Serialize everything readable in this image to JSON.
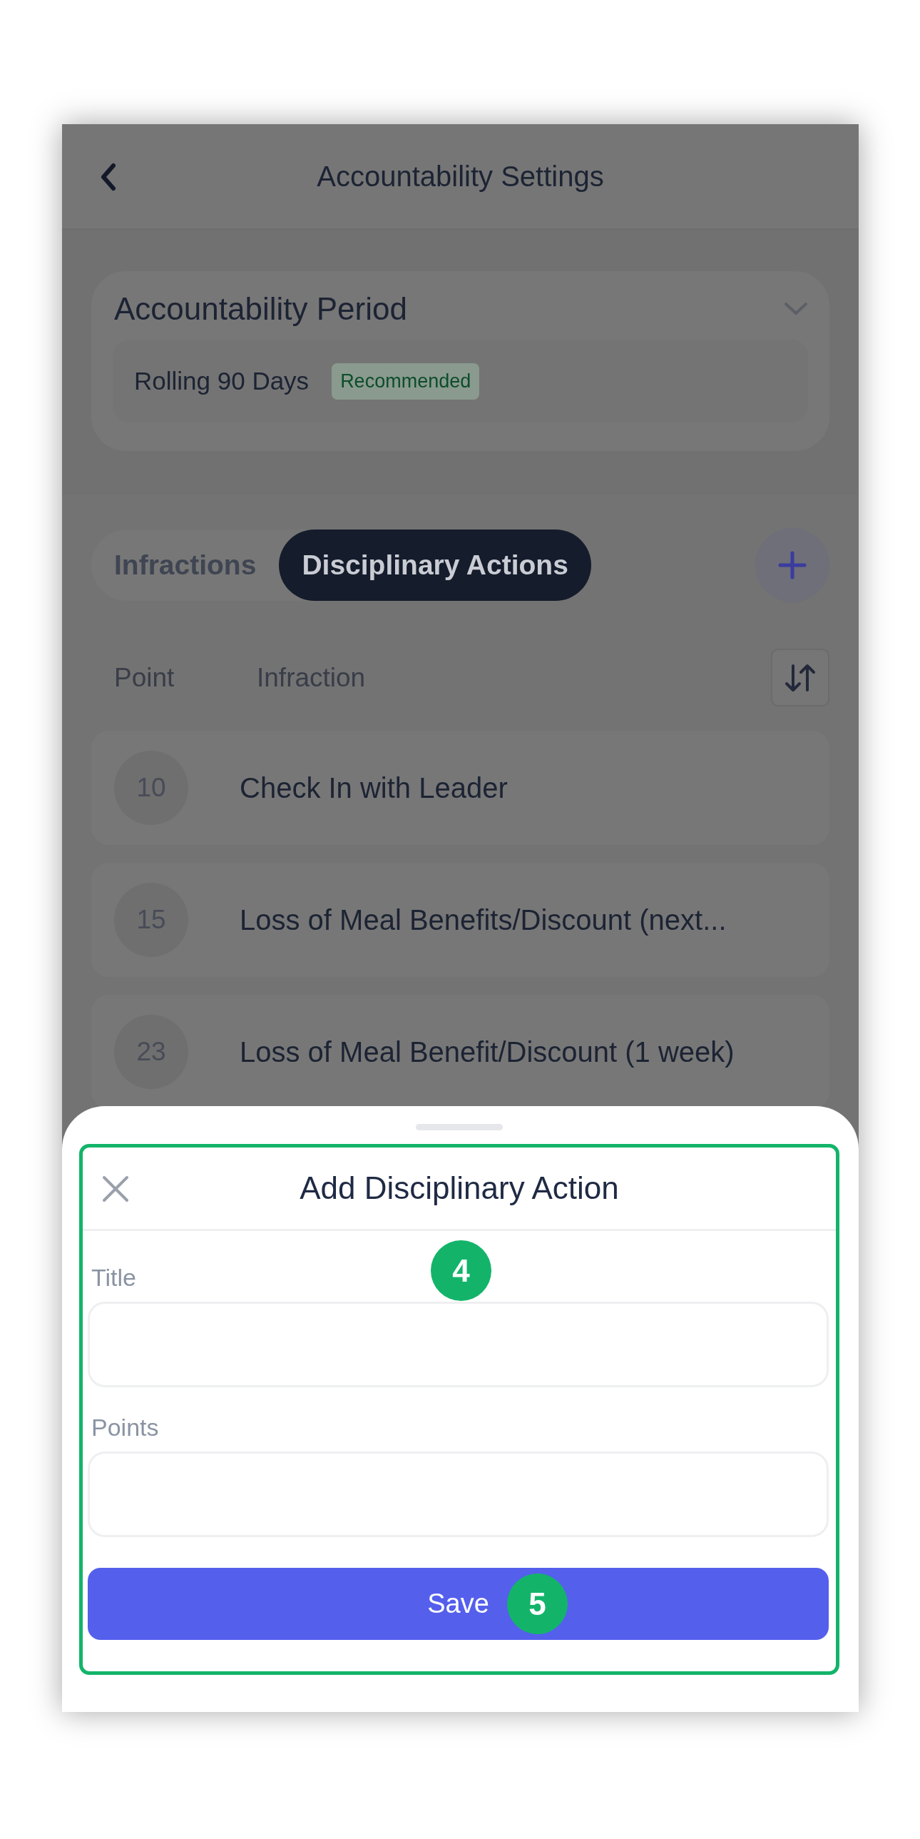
{
  "header": {
    "title": "Accountability Settings"
  },
  "period": {
    "title": "Accountability Period",
    "value": "Rolling 90 Days",
    "badge": "Recommended"
  },
  "tabs": [
    {
      "label": "Infractions",
      "selected": false
    },
    {
      "label": "Disciplinary Actions",
      "selected": true
    }
  ],
  "table": {
    "columns": [
      "Point",
      "Infraction"
    ],
    "rows": [
      {
        "points": "10",
        "title": "Check In with Leader"
      },
      {
        "points": "15",
        "title": "Loss of Meal Benefits/Discount (next..."
      },
      {
        "points": "23",
        "title": "Loss of Meal Benefit/Discount (1 week)"
      }
    ]
  },
  "sheet": {
    "title": "Add Disciplinary Action",
    "fields": [
      {
        "label": "Title"
      },
      {
        "label": "Points"
      }
    ],
    "button": "Save"
  },
  "annotations": [
    {
      "number": "4"
    },
    {
      "number": "5"
    }
  ]
}
